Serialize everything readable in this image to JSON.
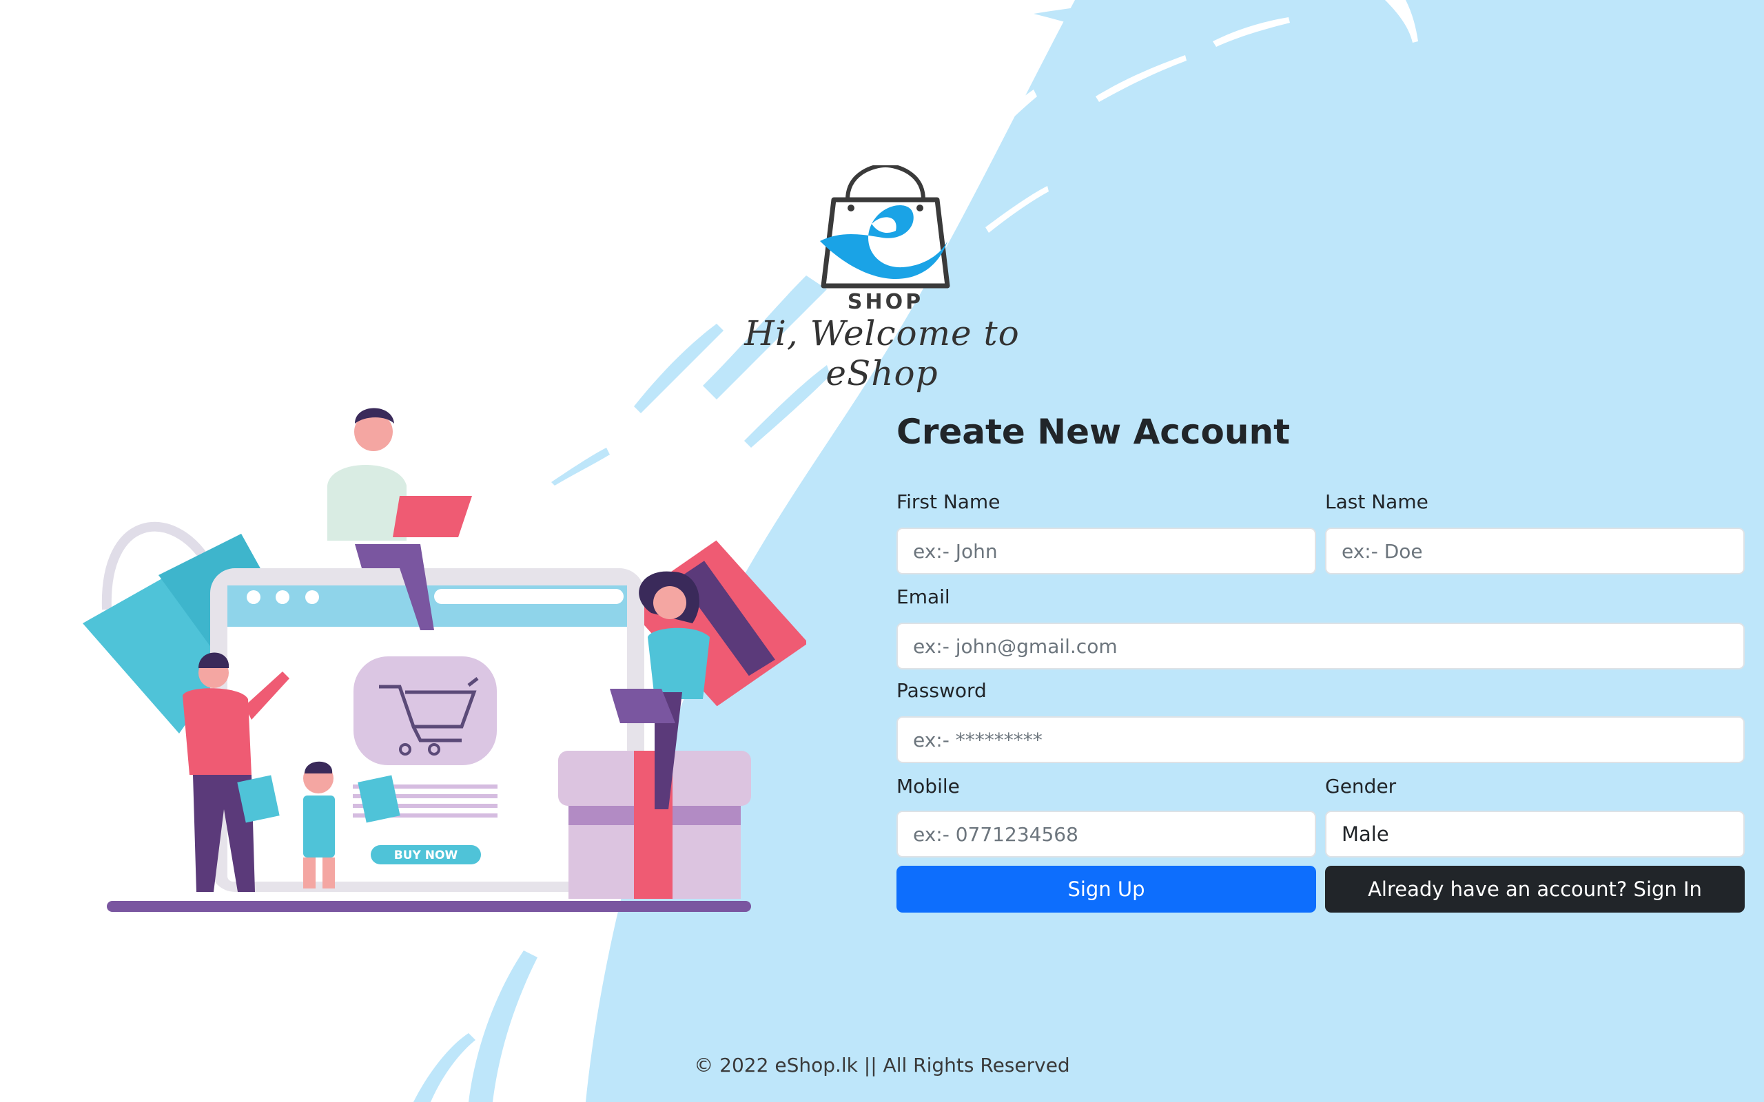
{
  "brand": {
    "logo_text": "SHOP",
    "welcome": "Hi, Welcome to eShop"
  },
  "form": {
    "title": "Create New Account",
    "first_name": {
      "label": "First Name",
      "placeholder": "ex:- John"
    },
    "last_name": {
      "label": "Last Name",
      "placeholder": "ex:- Doe"
    },
    "email": {
      "label": "Email",
      "placeholder": "ex:- john@gmail.com"
    },
    "password": {
      "label": "Password",
      "placeholder": "ex:- *********"
    },
    "mobile": {
      "label": "Mobile",
      "placeholder": "ex:- 0771234568"
    },
    "gender": {
      "label": "Gender",
      "value": "Male"
    },
    "signup_label": "Sign Up",
    "signin_label": "Already have an account? Sign In"
  },
  "illustration": {
    "buy_now": "BUY NOW"
  },
  "footer": {
    "text": "© 2022 eShop.lk || All Rights Reserved"
  },
  "colors": {
    "background_accent": "#bee6fa",
    "primary": "#0d6efd",
    "dark": "#212529",
    "logo_blue": "#1aa3e6"
  }
}
